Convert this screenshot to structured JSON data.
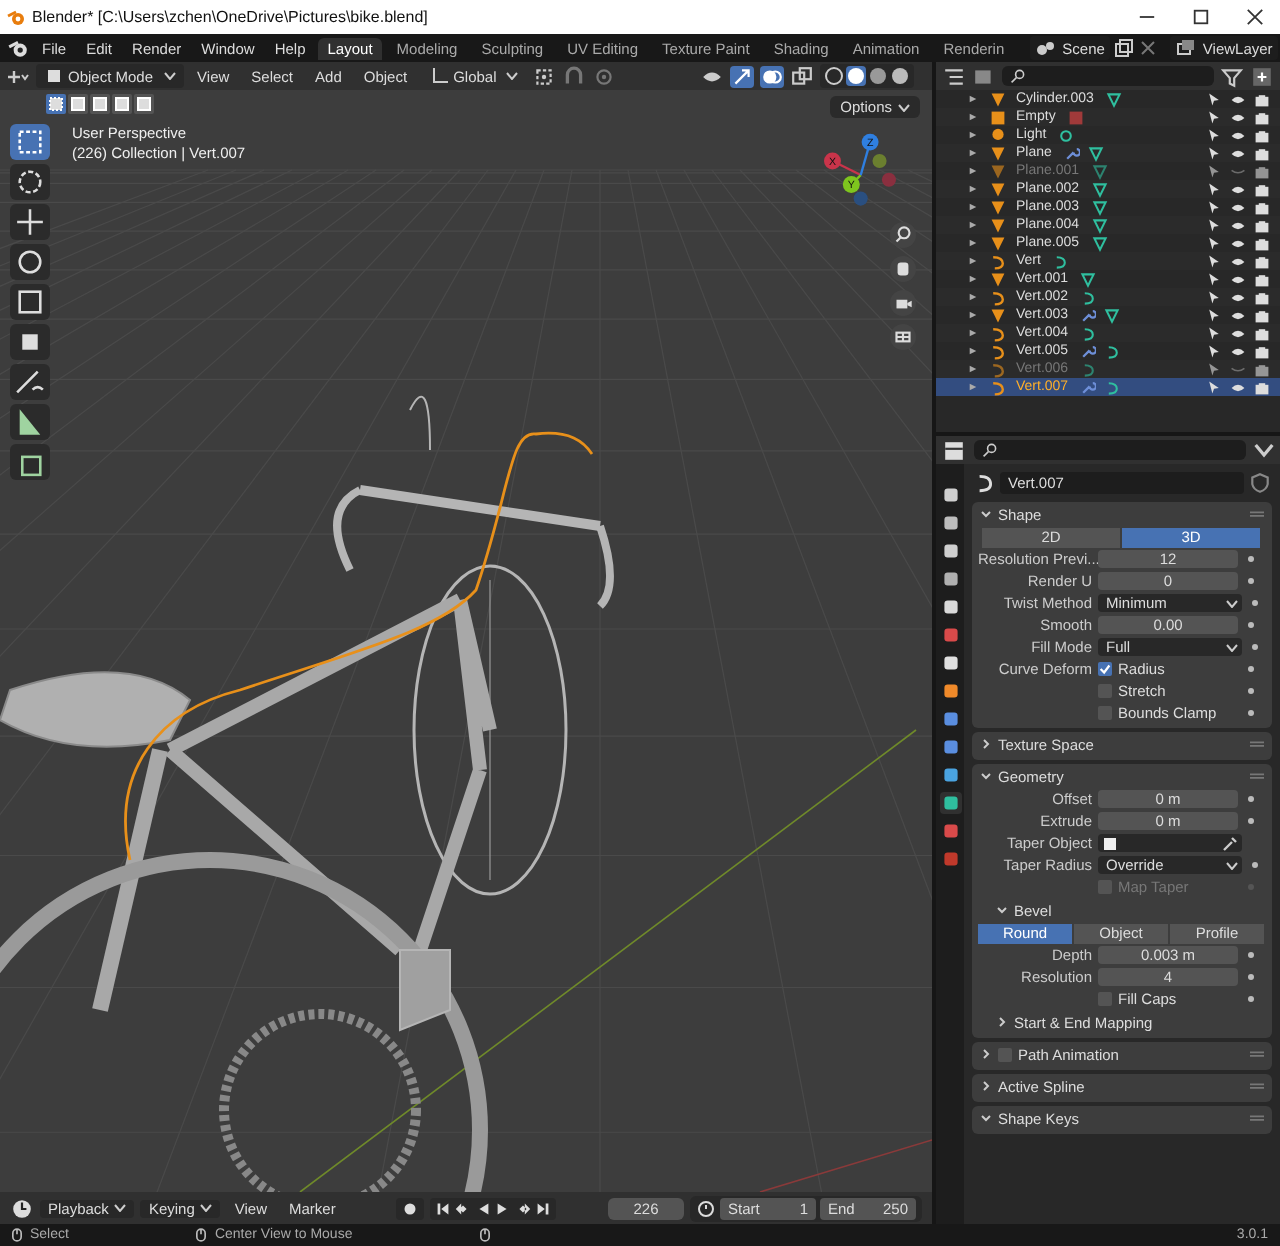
{
  "window": {
    "title": "Blender* [C:\\Users\\zchen\\OneDrive\\Pictures\\bike.blend]"
  },
  "menu": [
    "File",
    "Edit",
    "Render",
    "Window",
    "Help"
  ],
  "workspaces": [
    {
      "label": "Layout",
      "selected": true
    },
    {
      "label": "Modeling",
      "selected": false
    },
    {
      "label": "Sculpting",
      "selected": false
    },
    {
      "label": "UV Editing",
      "selected": false
    },
    {
      "label": "Texture Paint",
      "selected": false
    },
    {
      "label": "Shading",
      "selected": false
    },
    {
      "label": "Animation",
      "selected": false
    },
    {
      "label": "Renderin",
      "selected": false
    }
  ],
  "scene": "Scene",
  "view_layer": "ViewLayer",
  "viewport": {
    "mode": "Object Mode",
    "menus": [
      "View",
      "Select",
      "Add",
      "Object"
    ],
    "orientation": "Global",
    "options": "Options",
    "overlay_lines": [
      "User Perspective",
      "(226) Collection | Vert.007"
    ],
    "gizmo_axes": [
      "X",
      "Y",
      "Z"
    ]
  },
  "outliner": {
    "rows": [
      {
        "name": "Cylinder.003",
        "kind": "mesh",
        "modifier": false,
        "visible": true,
        "selected": false
      },
      {
        "name": "Empty",
        "kind": "empty",
        "modifier": false,
        "visible": true,
        "selected": false
      },
      {
        "name": "Light",
        "kind": "light",
        "modifier": false,
        "visible": true,
        "selected": false
      },
      {
        "name": "Plane",
        "kind": "mesh",
        "modifier": true,
        "visible": true,
        "selected": false
      },
      {
        "name": "Plane.001",
        "kind": "mesh",
        "modifier": false,
        "visible": false,
        "selected": false
      },
      {
        "name": "Plane.002",
        "kind": "mesh",
        "modifier": false,
        "visible": true,
        "selected": false
      },
      {
        "name": "Plane.003",
        "kind": "mesh",
        "modifier": false,
        "visible": true,
        "selected": false
      },
      {
        "name": "Plane.004",
        "kind": "mesh",
        "modifier": false,
        "visible": true,
        "selected": false
      },
      {
        "name": "Plane.005",
        "kind": "mesh",
        "modifier": false,
        "visible": true,
        "selected": false
      },
      {
        "name": "Vert",
        "kind": "curve",
        "modifier": false,
        "visible": true,
        "selected": false
      },
      {
        "name": "Vert.001",
        "kind": "mesh",
        "modifier": false,
        "visible": true,
        "selected": false
      },
      {
        "name": "Vert.002",
        "kind": "curve",
        "modifier": false,
        "visible": true,
        "selected": false
      },
      {
        "name": "Vert.003",
        "kind": "mesh",
        "modifier": true,
        "visible": true,
        "selected": false
      },
      {
        "name": "Vert.004",
        "kind": "curve",
        "modifier": false,
        "visible": true,
        "selected": false
      },
      {
        "name": "Vert.005",
        "kind": "curve",
        "modifier": true,
        "visible": true,
        "selected": false
      },
      {
        "name": "Vert.006",
        "kind": "curve",
        "modifier": false,
        "visible": false,
        "selected": false
      },
      {
        "name": "Vert.007",
        "kind": "curve",
        "modifier": true,
        "visible": true,
        "selected": true
      }
    ]
  },
  "properties": {
    "tabs": [
      {
        "color": "#cfcfcf",
        "selected": false
      },
      {
        "color": "#bdbdbd",
        "selected": false
      },
      {
        "color": "#cfcfcf",
        "selected": false
      },
      {
        "color": "#b0b0b0",
        "selected": false
      },
      {
        "color": "#d9d9d9",
        "selected": false
      },
      {
        "color": "#d94a4a",
        "selected": false
      },
      {
        "color": "#e0e0e0",
        "selected": false
      },
      {
        "color": "#f08a2a",
        "selected": false
      },
      {
        "color": "#5a8ee0",
        "selected": false
      },
      {
        "color": "#5a8ee0",
        "selected": false
      },
      {
        "color": "#4aa3e0",
        "selected": false
      },
      {
        "color": "#2fbf9f",
        "selected": true
      },
      {
        "color": "#d94a4a",
        "selected": false
      },
      {
        "color": "#c0392b",
        "selected": false
      }
    ],
    "name": "Vert.007",
    "panels": [
      {
        "title": "Shape",
        "expanded": true,
        "items": [
          {
            "kind": "segmented",
            "options": [
              {
                "label": "2D",
                "selected": false
              },
              {
                "label": "3D",
                "selected": true
              }
            ]
          },
          {
            "kind": "number",
            "label": "Resolution Previ...",
            "value": "12"
          },
          {
            "kind": "number",
            "label": "Render U",
            "value": "0"
          },
          {
            "kind": "dropdown",
            "label": "Twist Method",
            "value": "Minimum"
          },
          {
            "kind": "number",
            "label": "Smooth",
            "value": "0.00"
          },
          {
            "kind": "dropdown",
            "label": "Fill Mode",
            "value": "Full"
          },
          {
            "kind": "checkbox",
            "label": "Curve Deform",
            "text": "Radius",
            "checked": true,
            "disabled": false
          },
          {
            "kind": "checkbox",
            "text": "Stretch",
            "checked": false,
            "disabled": false
          },
          {
            "kind": "checkbox",
            "text": "Bounds Clamp",
            "checked": false,
            "disabled": false
          }
        ]
      },
      {
        "title": "Texture Space",
        "expanded": false
      },
      {
        "title": "Geometry",
        "expanded": true,
        "items": [
          {
            "kind": "number",
            "label": "Offset",
            "value": "0 m"
          },
          {
            "kind": "number",
            "label": "Extrude",
            "value": "0 m"
          },
          {
            "kind": "picker",
            "label": "Taper Object"
          },
          {
            "kind": "dropdown",
            "label": "Taper Radius",
            "value": "Override"
          },
          {
            "kind": "checkbox",
            "text": "Map Taper",
            "checked": false,
            "disabled": true
          },
          {
            "kind": "subpanel",
            "title": "Bevel",
            "expanded": true,
            "items": [
              {
                "kind": "segmented",
                "options": [
                  {
                    "label": "Round",
                    "selected": true
                  },
                  {
                    "label": "Object",
                    "selected": false
                  },
                  {
                    "label": "Profile",
                    "selected": false
                  }
                ]
              },
              {
                "kind": "number",
                "label": "Depth",
                "value": "0.003 m"
              },
              {
                "kind": "number",
                "label": "Resolution",
                "value": "4"
              },
              {
                "kind": "checkbox",
                "text": "Fill Caps",
                "checked": false,
                "disabled": false
              }
            ]
          },
          {
            "kind": "subpanel",
            "title": "Start & End Mapping",
            "expanded": false
          }
        ]
      },
      {
        "title": "Path Animation",
        "expanded": false,
        "enabled": false
      },
      {
        "title": "Active Spline",
        "expanded": false
      },
      {
        "title": "Shape Keys",
        "expanded": true
      }
    ]
  },
  "timeline": {
    "menus": [
      {
        "label": "Playback",
        "kind": "dropdown"
      },
      {
        "label": "Keying",
        "kind": "dropdown"
      },
      {
        "label": "View",
        "kind": "menu"
      },
      {
        "label": "Marker",
        "kind": "menu"
      }
    ],
    "frame": "226",
    "start": {
      "label": "Start",
      "value": "1"
    },
    "end": {
      "label": "End",
      "value": "250"
    }
  },
  "status_bar": {
    "hints": [
      "Select",
      "Center View to Mouse"
    ],
    "version": "3.0.1"
  }
}
